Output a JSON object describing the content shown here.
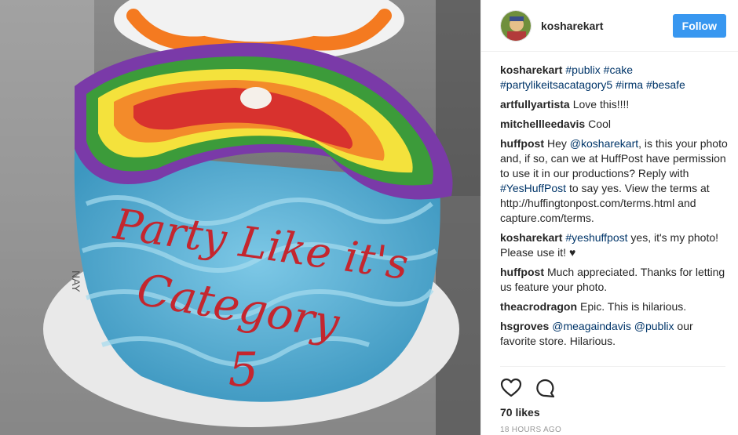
{
  "post": {
    "username": "kosharekart",
    "follow_label": "Follow",
    "caption_user": "kosharekart",
    "caption_segments": [
      "#publix",
      " ",
      "#cake",
      " ",
      "#partylikeitsacatagory5",
      " ",
      "#irma",
      " ",
      "#besafe"
    ],
    "comments": [
      {
        "user": "artfullyartista",
        "parts": [
          {
            "t": "Love this!!!!",
            "link": false
          }
        ]
      },
      {
        "user": "mitchellleedavis",
        "parts": [
          {
            "t": "Cool",
            "link": false
          }
        ]
      },
      {
        "user": "huffpost",
        "parts": [
          {
            "t": "Hey ",
            "link": false
          },
          {
            "t": "@kosharekart",
            "link": true
          },
          {
            "t": ", is this your photo and, if so, can we at HuffPost have permission to use it in our productions? Reply with ",
            "link": false
          },
          {
            "t": "#YesHuffPost",
            "link": true
          },
          {
            "t": " to say yes. View the terms at http://huffingtonpost.com/terms.html and capture.com/terms.",
            "link": false
          }
        ]
      },
      {
        "user": "kosharekart",
        "parts": [
          {
            "t": "#yeshuffpost",
            "link": true
          },
          {
            "t": " yes, it's my photo! Please use it! ♥",
            "link": false
          }
        ]
      },
      {
        "user": "huffpost",
        "parts": [
          {
            "t": "Much appreciated. Thanks for letting us feature your photo.",
            "link": false
          }
        ]
      },
      {
        "user": "theacrodragon",
        "parts": [
          {
            "t": "Epic. This is hilarious.",
            "link": false
          }
        ]
      },
      {
        "user": "hsgroves",
        "parts": [
          {
            "t": "@meagaindavis",
            "link": true
          },
          {
            "t": " ",
            "link": false
          },
          {
            "t": "@publix",
            "link": true
          },
          {
            "t": " our favorite store. Hilarious.",
            "link": false
          }
        ]
      }
    ],
    "likes": "70 likes",
    "time": "18 HOURS AGO",
    "icons": {
      "like": "heart-icon",
      "comment": "comment-bubble-icon"
    },
    "cake_text": [
      "Party Like it's",
      "Category",
      "5"
    ],
    "board_label": "NAY",
    "colors": {
      "follow": "#3897f0",
      "link": "#003569",
      "frosting": "#58b4d8",
      "writing": "#c4262e"
    }
  }
}
